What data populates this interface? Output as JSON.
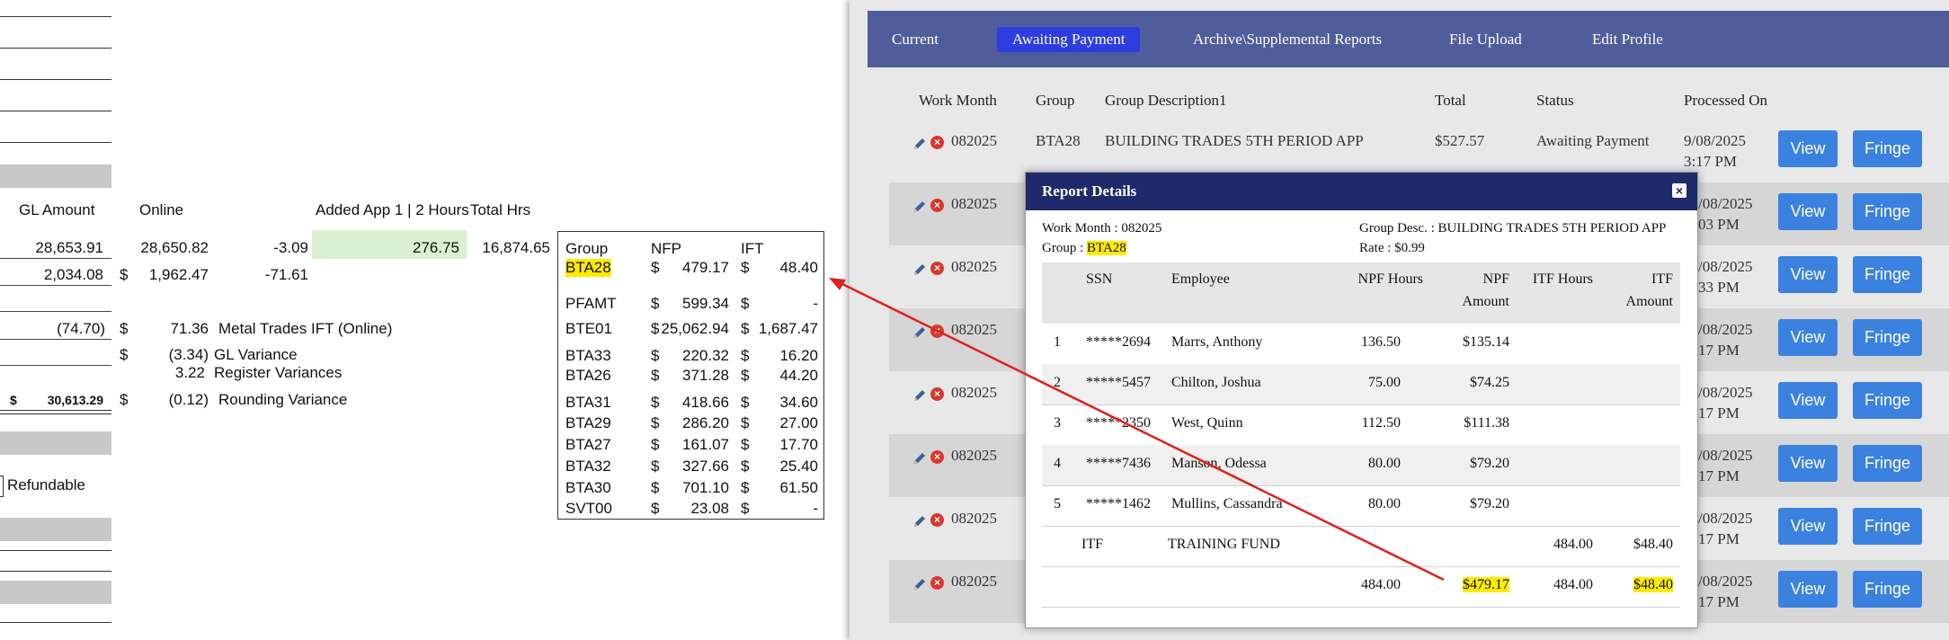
{
  "sheet": {
    "headers": {
      "gl_amount": "GL Amount",
      "online": "Online",
      "added_app": "Added App 1 | 2 Hours",
      "total_hrs": "Total Hrs"
    },
    "row1": {
      "gl": "28,653.91",
      "online": "28,650.82",
      "diff": "-3.09",
      "added": "276.75",
      "total": "16,874.65"
    },
    "row2": {
      "gl": "2,034.08",
      "cur": "$",
      "online": "1,962.47",
      "diff": "-71.61"
    },
    "row3": {
      "gl": "(74.70)",
      "cur": "$",
      "online": "71.36",
      "label": "Metal Trades IFT (Online)"
    },
    "row4": {
      "cur": "$",
      "online": "(3.34)",
      "label": "GL Variance"
    },
    "row5": {
      "online": "3.22",
      "label": "Register Variances"
    },
    "row6": {
      "cur": "$",
      "gl": "30,613.29",
      "cur2": "$",
      "online": "(0.12)",
      "label": "Rounding Variance"
    },
    "refundable": "Refundable",
    "nfp_table": {
      "headers": [
        "Group",
        "NFP",
        "IFT"
      ],
      "rows": [
        {
          "group": "BTA28",
          "nfp": "479.17",
          "ift": "48.40"
        },
        {
          "group": "PFAMT",
          "nfp": "599.34",
          "ift": "-"
        },
        {
          "group": "BTE01",
          "nfp": "25,062.94",
          "ift": "1,687.47"
        },
        {
          "group": "BTA33",
          "nfp": "220.32",
          "ift": "16.20"
        },
        {
          "group": "BTA26",
          "nfp": "371.28",
          "ift": "44.20"
        },
        {
          "group": "BTA31",
          "nfp": "418.66",
          "ift": "34.60"
        },
        {
          "group": "BTA29",
          "nfp": "286.20",
          "ift": "27.00"
        },
        {
          "group": "BTA27",
          "nfp": "161.07",
          "ift": "17.70"
        },
        {
          "group": "BTA32",
          "nfp": "327.66",
          "ift": "25.40"
        },
        {
          "group": "BTA30",
          "nfp": "701.10",
          "ift": "61.50"
        },
        {
          "group": "SVT00",
          "nfp": "23.08",
          "ift": "-"
        }
      ],
      "currency": "$"
    }
  },
  "nav": {
    "items": [
      "Current",
      "Awaiting Payment",
      "Archive\\Supplemental Reports",
      "File Upload",
      "Edit Profile"
    ],
    "active": "Awaiting Payment"
  },
  "table": {
    "headers": [
      "Work Month",
      "Group",
      "Group Description1",
      "Total",
      "Status",
      "Processed On"
    ],
    "first_row": {
      "work_month": "082025",
      "group": "BTA28",
      "description": "BUILDING TRADES 5TH PERIOD APP",
      "total": "$527.57",
      "status": "Awaiting Payment",
      "processed_date": "9/08/2025",
      "processed_time": "3:17 PM"
    },
    "other_rows": [
      {
        "work_month": "082025",
        "date": "/08/2025",
        "time": "03 PM"
      },
      {
        "work_month": "082025",
        "date": "/08/2025",
        "time": "33 PM"
      },
      {
        "work_month": "082025",
        "date": "/08/2025",
        "time": "17 PM"
      },
      {
        "work_month": "082025",
        "date": "/08/2025",
        "time": "17 PM"
      },
      {
        "work_month": "082025",
        "date": "/08/2025",
        "time": "17 PM"
      },
      {
        "work_month": "082025",
        "date": "/08/2025",
        "time": "17 PM"
      },
      {
        "work_month": "082025",
        "date": "/08/2025",
        "time": "17 PM"
      }
    ],
    "view_label": "View",
    "fringe_label": "Fringe"
  },
  "modal": {
    "title": "Report Details",
    "work_month": "Work Month : 082025",
    "group_label": "Group : ",
    "group_value": "BTA28",
    "group_desc": "Group Desc. : BUILDING TRADES 5TH PERIOD APP",
    "rate": "Rate : $0.99",
    "headers": {
      "ssn": "SSN",
      "employee": "Employee",
      "npf_hours": "NPF Hours",
      "npf_amount_1": "NPF",
      "npf_amount_2": "Amount",
      "itf_hours": "ITF Hours",
      "itf_amount_1": "ITF",
      "itf_amount_2": "Amount"
    },
    "rows": [
      {
        "n": "1",
        "ssn": "*****2694",
        "employee": "Marrs, Anthony",
        "npf_hours": "136.50",
        "npf_amount": "$135.14"
      },
      {
        "n": "2",
        "ssn": "*****5457",
        "employee": "Chilton, Joshua",
        "npf_hours": "75.00",
        "npf_amount": "$74.25"
      },
      {
        "n": "3",
        "ssn": "*****2350",
        "employee": "West, Quinn",
        "npf_hours": "112.50",
        "npf_amount": "$111.38"
      },
      {
        "n": "4",
        "ssn": "*****7436",
        "employee": "Manson, Odessa",
        "npf_hours": "80.00",
        "npf_amount": "$79.20"
      },
      {
        "n": "5",
        "ssn": "*****1462",
        "employee": "Mullins, Cassandra",
        "npf_hours": "80.00",
        "npf_amount": "$79.20"
      }
    ],
    "itf_row": {
      "label": "ITF",
      "desc": "TRAINING FUND",
      "itf_hours": "484.00",
      "itf_amount": "$48.40"
    },
    "totals": {
      "npf_hours": "484.00",
      "npf_amount": "$479.17",
      "itf_hours": "484.00",
      "itf_amount": "$48.40"
    }
  },
  "colors": {
    "nav": "#4f5e9b",
    "nav_active": "#2e3de0",
    "modal_header": "#1f2a6b",
    "button": "#3b82e0",
    "highlight": "#ffeb00",
    "arrow": "#e0201c"
  }
}
